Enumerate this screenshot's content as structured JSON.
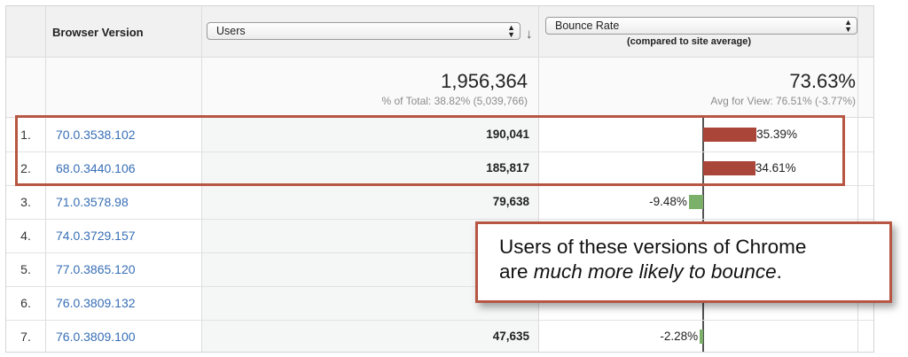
{
  "header": {
    "browser_version_label": "Browser Version",
    "users_select_value": "Users",
    "bounce_select_value": "Bounce Rate",
    "compared_label": "(compared to site average)",
    "sort_icon": "sort-down-arrow"
  },
  "totals": {
    "users_total": "1,956,364",
    "users_subtitle": "% of Total: 38.82% (5,039,766)",
    "bounce_total": "73.63%",
    "bounce_subtitle": "Avg for View: 76.51% (-3.77%)"
  },
  "rows": [
    {
      "num": "1.",
      "version": "70.0.3538.102",
      "users": "190,041",
      "pct_label": "35.39%",
      "pct": 35.39
    },
    {
      "num": "2.",
      "version": "68.0.3440.106",
      "users": "185,817",
      "pct_label": "34.61%",
      "pct": 34.61
    },
    {
      "num": "3.",
      "version": "71.0.3578.98",
      "users": "79,638",
      "pct_label": "-9.48%",
      "pct": -9.48
    },
    {
      "num": "4.",
      "version": "74.0.3729.157",
      "users": "",
      "pct_label": "",
      "pct": null
    },
    {
      "num": "5.",
      "version": "77.0.3865.120",
      "users": "",
      "pct_label": "",
      "pct": null
    },
    {
      "num": "6.",
      "version": "76.0.3809.132",
      "users": "",
      "pct_label": "",
      "pct": null
    },
    {
      "num": "7.",
      "version": "76.0.3809.100",
      "users": "47,635",
      "pct_label": "-2.28%",
      "pct": -2.28
    }
  ],
  "callout": {
    "line1": "Users of these versions of Chrome",
    "line2_prefix": "are ",
    "line2_emphasis": "much more likely to bounce",
    "line2_suffix": "."
  },
  "colors": {
    "positive_bar": "#a94539",
    "negative_bar": "#7bb06a",
    "link": "#376eb5",
    "highlight": "#b75643"
  }
}
